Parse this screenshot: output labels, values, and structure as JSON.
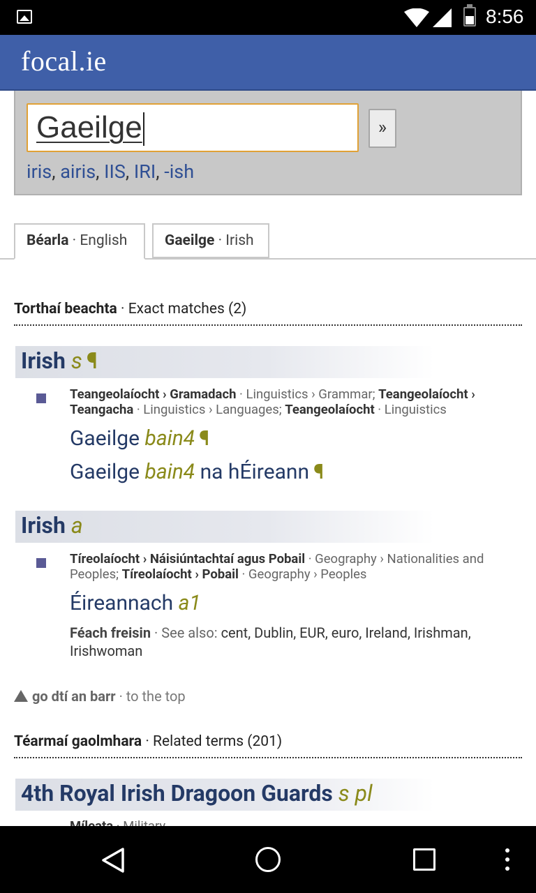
{
  "status_bar": {
    "time": "8:56",
    "icons": [
      "image-notification-icon",
      "wifi-icon",
      "signal-icon",
      "battery-icon"
    ]
  },
  "header": {
    "logo": "focal.ie"
  },
  "search": {
    "value": "Gaeilge",
    "go_label": "»",
    "suggestions": [
      "iris",
      "airis",
      "IIS",
      "IRI",
      "-ish"
    ]
  },
  "tabs": [
    {
      "bold": "Béarla",
      "label": "English",
      "active": true
    },
    {
      "bold": "Gaeilge",
      "label": "Irish",
      "active": false
    }
  ],
  "exact": {
    "heading_bold": "Torthaí beachta",
    "heading": "Exact matches (2)",
    "entries": [
      {
        "term": "Irish",
        "pos": "s",
        "pilcrow": "¶",
        "domain_1_ga": "Teangeolaíocht › Gramadach",
        "domain_1_en": "Linguistics › Grammar;",
        "domain_2_ga": "Teangeolaíocht › Teangacha",
        "domain_2_en": "Linguistics › Languages;",
        "domain_3_ga": "Teangeolaíocht",
        "domain_3_en": "Linguistics",
        "translations": [
          {
            "text": "Gaeilge",
            "pos": "bain4",
            "suffix": "",
            "pilcrow": "¶"
          },
          {
            "text": "Gaeilge",
            "pos": "bain4",
            "suffix": "na hÉireann",
            "pilcrow": "¶"
          }
        ]
      },
      {
        "term": "Irish",
        "pos": "a",
        "domain_1_ga": "Tíreolaíocht › Náisiúntachtaí agus Pobail",
        "domain_1_en": "Geography › Nationalities and Peoples;",
        "domain_2_ga": "Tíreolaíocht › Pobail",
        "domain_2_en": "Geography › Peoples",
        "translation": {
          "text": "Éireannach",
          "pos": "a1"
        },
        "see_also_ga": "Féach freisin",
        "see_also_en": "See also:",
        "see_also": "cent, Dublin, EUR, euro, Ireland, Irishman, Irishwoman"
      }
    ]
  },
  "to_top": {
    "bold": "go dtí an barr",
    "label": "to the top"
  },
  "related": {
    "heading_bold": "Téarmaí gaolmhara",
    "heading": "Related terms (201)",
    "first_term": "4th Royal Irish Dragoon Guards",
    "first_pos": "s pl",
    "first_domain_ga": "Míleata",
    "first_domain_en": "Military"
  }
}
